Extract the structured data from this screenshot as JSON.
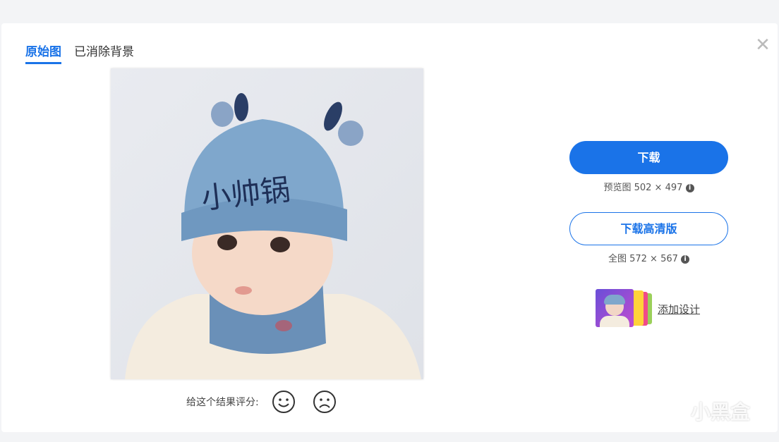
{
  "tabs": [
    {
      "label": "原始图",
      "active": true
    },
    {
      "label": "已消除背景",
      "active": false
    }
  ],
  "close_icon": "close-icon",
  "photo": {
    "hat_text": "小帅锅"
  },
  "rating": {
    "label": "给这个结果评分:",
    "icons": [
      "smile-icon",
      "frown-icon"
    ]
  },
  "download": {
    "primary_label": "下载",
    "preview_info": "预览图 502 × 497",
    "hd_label": "下载高清版",
    "full_info": "全图 572 × 567"
  },
  "add_design": {
    "label": "添加设计"
  },
  "watermark": {
    "text": "小黑盒"
  },
  "colors": {
    "accent": "#1a73e8",
    "background": "#f3f4f6"
  }
}
